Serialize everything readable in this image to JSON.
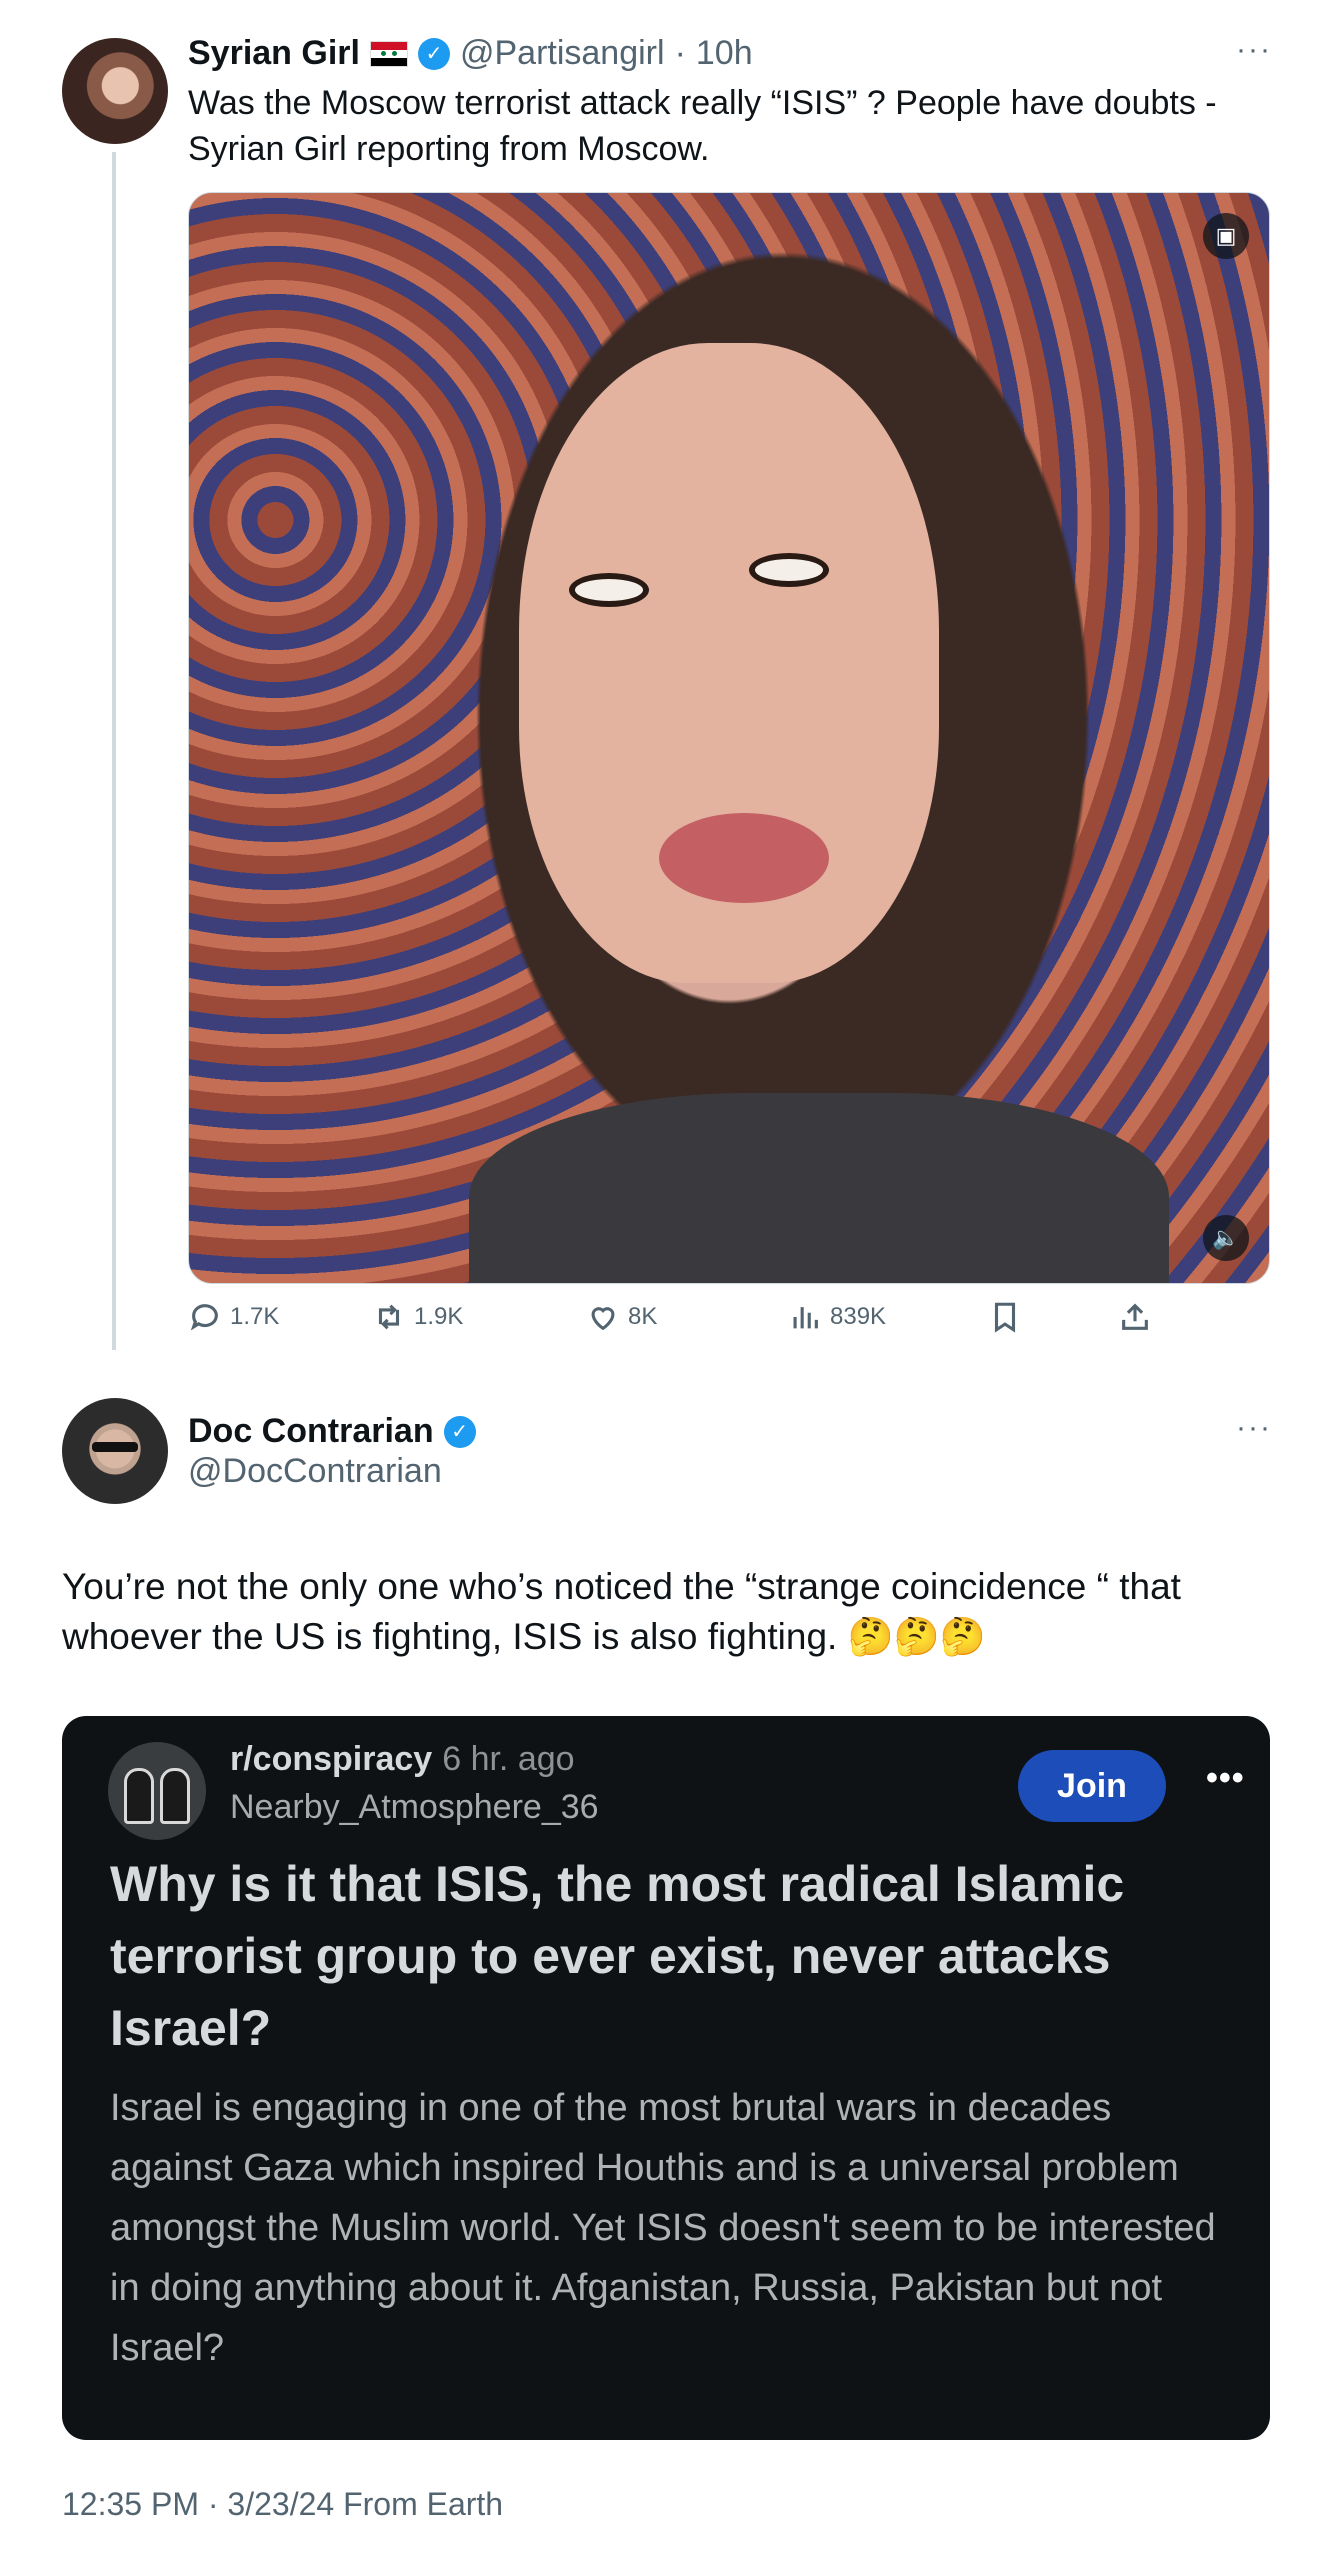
{
  "tweet1": {
    "display_name": "Syrian Girl",
    "handle": "@Partisangirl",
    "separator": "·",
    "age": "10h",
    "text": "Was the Moscow terrorist attack really “ISIS” ? People have doubts - Syrian Girl reporting from Moscow.",
    "flag_icon": "syria-flag-icon",
    "stats": {
      "replies": "1.7K",
      "reposts": "1.9K",
      "likes": "8K",
      "views": "839K"
    }
  },
  "tweet2": {
    "display_name": "Doc Contrarian",
    "handle": "@DocContrarian",
    "text": "You’re not the only one who’s noticed the “strange coincidence “ that whoever the US is fighting, ISIS is also fighting. 🤔🤔🤔",
    "timestamp": "12:35 PM · 3/23/24 From Earth"
  },
  "reddit_card": {
    "subreddit": "r/conspiracy",
    "age": "6 hr. ago",
    "username": "Nearby_Atmosphere_36",
    "join_label": "Join",
    "more_label": "•••",
    "title": "Why is it that ISIS, the most radical Islamic terrorist group to ever exist, never attacks Israel?",
    "body": "Israel is engaging in one of the most brutal wars in decades against Gaza which inspired Houthis and is a universal problem amongst the Muslim world. Yet ISIS doesn't seem to be interested in doing anything about it. Afganistan, Russia, Pakistan but not Israel?",
    "background": "#0f1214",
    "join_color": "#1d4db8"
  },
  "colors": {
    "verified": "#1d9bf0",
    "secondary_text": "#536471",
    "thread_line": "#cfd9de"
  }
}
